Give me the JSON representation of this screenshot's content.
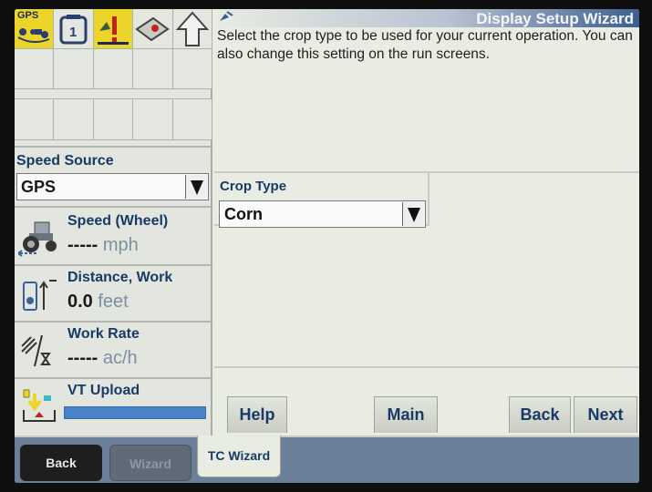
{
  "header": {
    "title": "Display Setup Wizard",
    "gps_icon_label": "GPS"
  },
  "instruction": "Select the crop type to be used for your current operation. You can also change this setting on the run screens.",
  "crop": {
    "label": "Crop Type",
    "value": "Corn"
  },
  "left_panel": {
    "speed_source_label": "Speed Source",
    "speed_source_value": "GPS",
    "speed": {
      "title": "Speed (Wheel)",
      "value": "-----",
      "unit": "mph"
    },
    "distance": {
      "title": "Distance, Work",
      "value": "0.0",
      "unit": "feet"
    },
    "work_rate": {
      "title": "Work Rate",
      "value": "-----",
      "unit": "ac/h"
    },
    "vt_upload": {
      "title": "VT Upload",
      "progress": 1.0
    }
  },
  "buttons": {
    "help": "Help",
    "main": "Main",
    "back": "Back",
    "next": "Next"
  },
  "tabs": {
    "back": "Back",
    "wizard": "Wizard",
    "tc_wizard": "TC Wizard"
  },
  "colors": {
    "title_blue": "#173a66",
    "accent_yellow": "#ecd52b",
    "progress_blue": "#4a83c9",
    "tab_bar": "#6c7f98"
  },
  "icons": [
    "gps-icon",
    "task-icon",
    "alarm-icon",
    "field-icon",
    "up-arrow-icon",
    "tractor-speed-icon",
    "distance-icon",
    "work-rate-icon",
    "vt-upload-icon",
    "satellite-icon"
  ]
}
